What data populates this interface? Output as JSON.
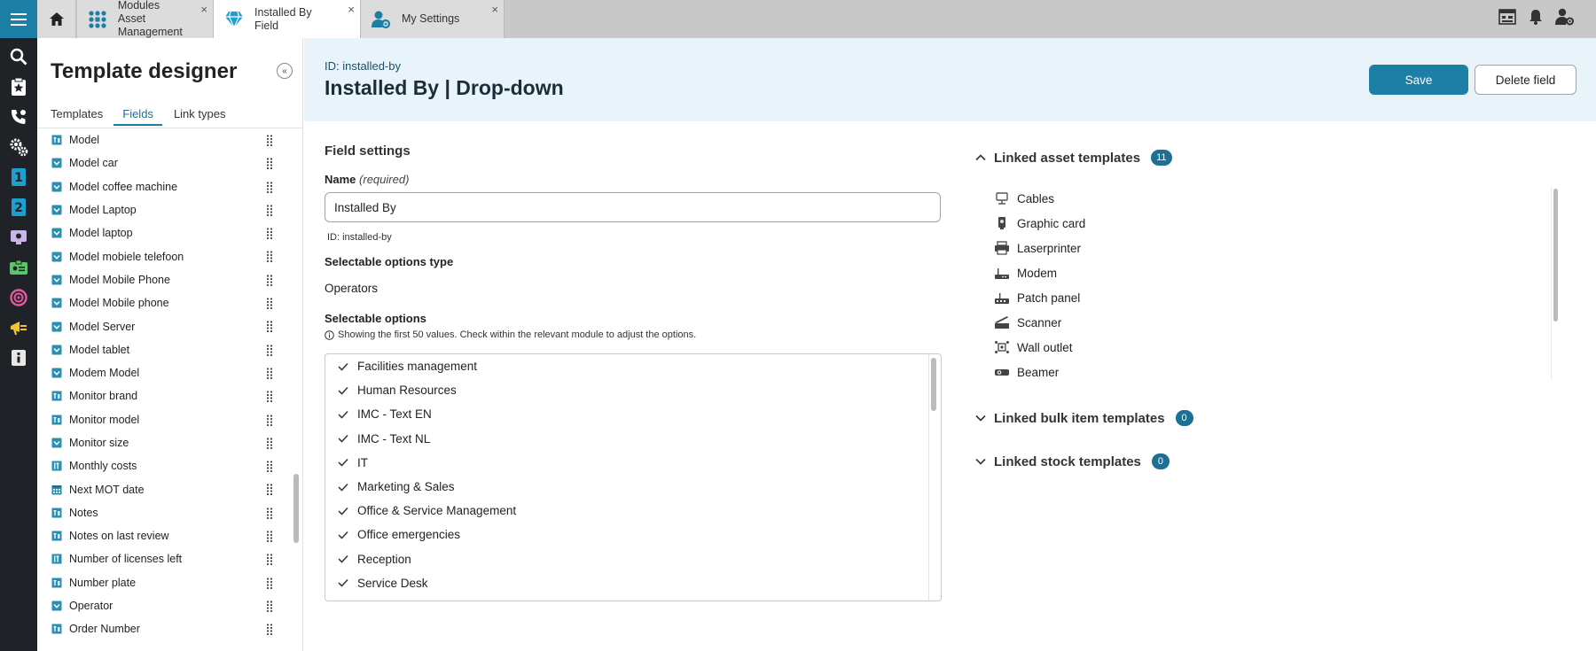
{
  "tabs": [
    {
      "line1": "Modules",
      "line2": "Asset Management",
      "icon": "modules-grid-icon",
      "state": "inactive"
    },
    {
      "line1": "Installed By",
      "line2": "Field",
      "icon": "diamond-icon",
      "state": "active"
    },
    {
      "line1": "My Settings",
      "line2": "",
      "icon": "user-settings-icon",
      "state": "inactive"
    }
  ],
  "tab_close": "×",
  "sidebar": {
    "title": "Template designer",
    "collapse": "«",
    "tabs": [
      "Templates",
      "Fields",
      "Link types"
    ],
    "active_tab": "Fields",
    "fields": [
      {
        "label": "Model",
        "icon": "text-field-icon"
      },
      {
        "label": "Model car",
        "icon": "dropdown-field-icon"
      },
      {
        "label": "Model coffee machine",
        "icon": "dropdown-field-icon"
      },
      {
        "label": "Model Laptop",
        "icon": "dropdown-field-icon"
      },
      {
        "label": "Model laptop",
        "icon": "dropdown-field-icon"
      },
      {
        "label": "Model mobiele telefoon",
        "icon": "dropdown-field-icon"
      },
      {
        "label": "Model Mobile Phone",
        "icon": "dropdown-field-icon"
      },
      {
        "label": "Model Mobile phone",
        "icon": "dropdown-field-icon"
      },
      {
        "label": "Model Server",
        "icon": "dropdown-field-icon"
      },
      {
        "label": "Model tablet",
        "icon": "dropdown-field-icon"
      },
      {
        "label": "Modem Model",
        "icon": "dropdown-field-icon"
      },
      {
        "label": "Monitor brand",
        "icon": "text-field-icon"
      },
      {
        "label": "Monitor model",
        "icon": "text-field-icon"
      },
      {
        "label": "Monitor size",
        "icon": "dropdown-field-icon"
      },
      {
        "label": "Monthly costs",
        "icon": "number-field-icon"
      },
      {
        "label": "Next MOT date",
        "icon": "date-field-icon"
      },
      {
        "label": "Notes",
        "icon": "text-field-icon"
      },
      {
        "label": "Notes on last review",
        "icon": "text-field-icon"
      },
      {
        "label": "Number of licenses left",
        "icon": "number-field-icon"
      },
      {
        "label": "Number plate",
        "icon": "text-field-icon"
      },
      {
        "label": "Operator",
        "icon": "dropdown-field-icon"
      },
      {
        "label": "Order Number",
        "icon": "text-field-icon"
      }
    ]
  },
  "main": {
    "id_text": "ID: installed-by",
    "title": "Installed By | Drop-down",
    "save_label": "Save",
    "delete_label": "Delete field",
    "settings_title": "Field settings",
    "name_label": "Name",
    "name_required": "(required)",
    "name_value": "Installed By",
    "name_id": "ID: installed-by",
    "options_type_label": "Selectable options type",
    "options_type_value": "Operators",
    "options_label": "Selectable options",
    "options_info": "Showing the first 50 values. Check within the relevant module to adjust the options.",
    "options": [
      "Facilities management",
      "Human Resources",
      "IMC - Text EN",
      "IMC - Text NL",
      "IT",
      "Marketing & Sales",
      "Office & Service Management",
      "Office emergencies",
      "Reception",
      "Service Desk"
    ]
  },
  "right": {
    "asset_title": "Linked asset templates",
    "asset_count": "11",
    "assets": [
      {
        "label": "Cables",
        "icon": "cables-icon"
      },
      {
        "label": "Graphic card",
        "icon": "graphic-card-icon"
      },
      {
        "label": "Laserprinter",
        "icon": "printer-icon"
      },
      {
        "label": "Modem",
        "icon": "modem-icon"
      },
      {
        "label": "Patch panel",
        "icon": "patch-panel-icon"
      },
      {
        "label": "Scanner",
        "icon": "scanner-icon"
      },
      {
        "label": "Wall outlet",
        "icon": "wall-outlet-icon"
      },
      {
        "label": "Beamer",
        "icon": "beamer-icon"
      }
    ],
    "bulk_title": "Linked bulk item templates",
    "bulk_count": "0",
    "stock_title": "Linked stock templates",
    "stock_count": "0"
  },
  "colors": {
    "accent": "#1d7fa6",
    "rail": "#1f2328",
    "header_bg": "#e9f4fa",
    "field_icon": "#2a8fb0"
  }
}
